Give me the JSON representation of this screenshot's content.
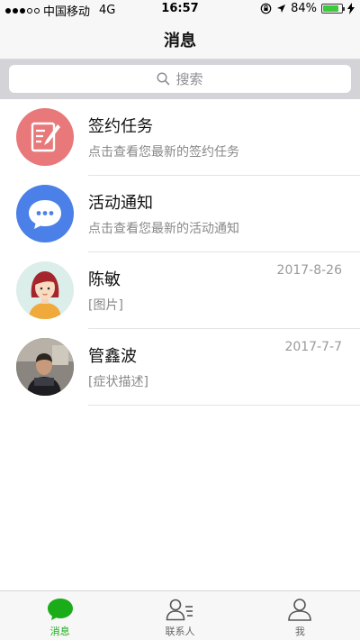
{
  "status_bar": {
    "carrier": "中国移动",
    "network": "4G",
    "time": "16:57",
    "battery": "84%",
    "battery_level": 0.84
  },
  "nav": {
    "title": "消息"
  },
  "search": {
    "placeholder": "搜索"
  },
  "conversations": [
    {
      "title": "签约任务",
      "subtitle": "点击查看您最新的签约任务",
      "time": "",
      "avatar": "contract-task-icon",
      "avatar_color": "#e8787a"
    },
    {
      "title": "活动通知",
      "subtitle": "点击查看您最新的活动通知",
      "time": "",
      "avatar": "chat-bubble-icon",
      "avatar_color": "#4a80e8"
    },
    {
      "title": "陈敏",
      "subtitle": "[图片]",
      "time": "2017-8-26",
      "avatar": "woman-avatar"
    },
    {
      "title": "管鑫波",
      "subtitle": "[症状描述]",
      "time": "2017-7-7",
      "avatar": "user-photo-avatar"
    }
  ],
  "tabs": [
    {
      "label": "消息",
      "icon": "message-bubble-icon",
      "active": true
    },
    {
      "label": "联系人",
      "icon": "contacts-icon",
      "active": false
    },
    {
      "label": "我",
      "icon": "profile-icon",
      "active": false
    }
  ],
  "colors": {
    "accent": "#1aad19"
  }
}
